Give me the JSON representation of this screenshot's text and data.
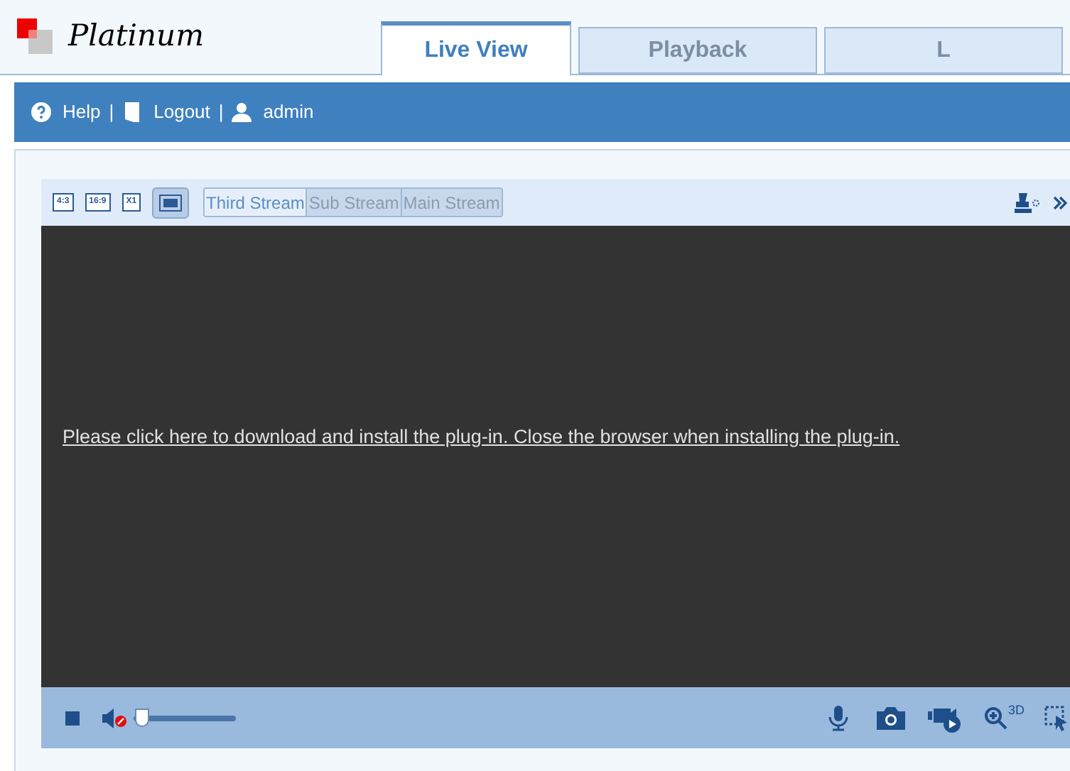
{
  "logo": {
    "text": "Platinum"
  },
  "tabs": [
    {
      "label": "Live View",
      "selected": true
    },
    {
      "label": "Playback",
      "selected": false
    },
    {
      "label": "L",
      "selected": false
    }
  ],
  "user_bar": [
    {
      "kind": "help",
      "label": "Help"
    },
    {
      "kind": "logout",
      "separator": "|",
      "label": "Logout"
    },
    {
      "kind": "user",
      "separator": "|",
      "label": "admin"
    }
  ],
  "ratio_buttons": [
    {
      "label": "4:3",
      "selected": false
    },
    {
      "label": "16:9",
      "selected": false
    },
    {
      "label": "X1",
      "selected": false
    },
    {
      "kind": "fit",
      "selected": true
    }
  ],
  "streams": [
    {
      "label": "Third Stream",
      "selected": true
    },
    {
      "label": "Sub Stream",
      "selected": false
    },
    {
      "label": "Main Stream",
      "selected": false
    }
  ],
  "video": {
    "message": "Please click here to download and install the plug-in. Close the browser when installing the plug-in."
  },
  "audio": {
    "muted": true,
    "level": 0.02
  },
  "zoom_3d": {
    "label": "3D"
  }
}
